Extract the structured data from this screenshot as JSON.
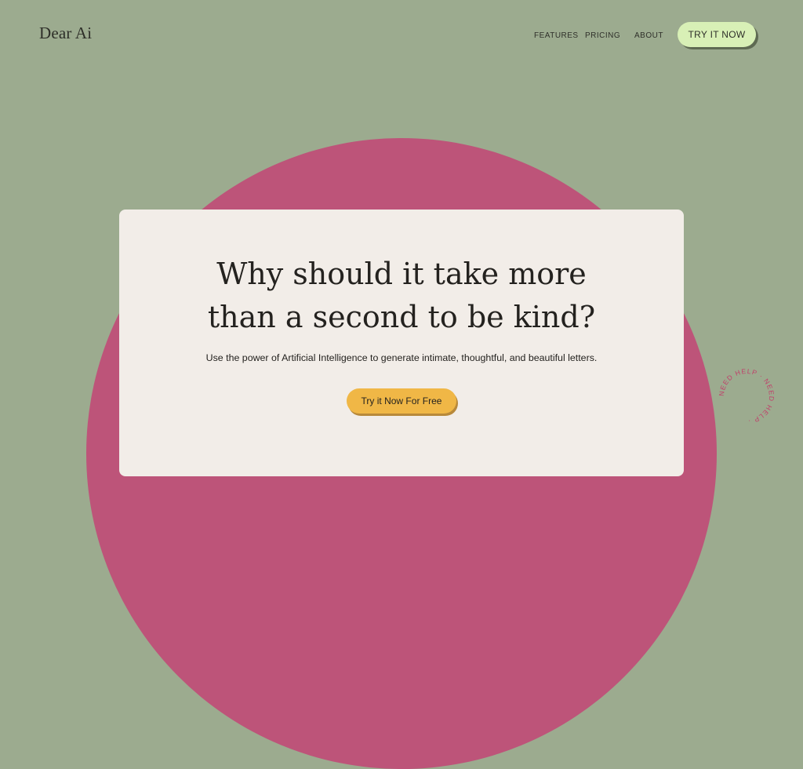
{
  "header": {
    "logo": "Dear Ai",
    "nav": [
      {
        "label": "FEATURES"
      },
      {
        "label": "PRICING"
      },
      {
        "label": "ABOUT"
      }
    ],
    "cta_label": "TRY IT NOW"
  },
  "hero": {
    "headline_line1": "Why should it take more",
    "headline_line2": "than a second to be kind?",
    "subtitle": "Use the power of Artificial Intelligence to generate intimate, thoughtful, and beautiful letters.",
    "cta_label": "Try it Now For Free"
  },
  "help_badge": {
    "text": "NEED HELP · NEED HELP · "
  },
  "colors": {
    "background": "#9cab8f",
    "circle": "#bd5479",
    "card": "#f2ede8",
    "nav_cta": "#d8f0b6",
    "hero_cta": "#f0b746",
    "badge_text": "#c0406a"
  }
}
